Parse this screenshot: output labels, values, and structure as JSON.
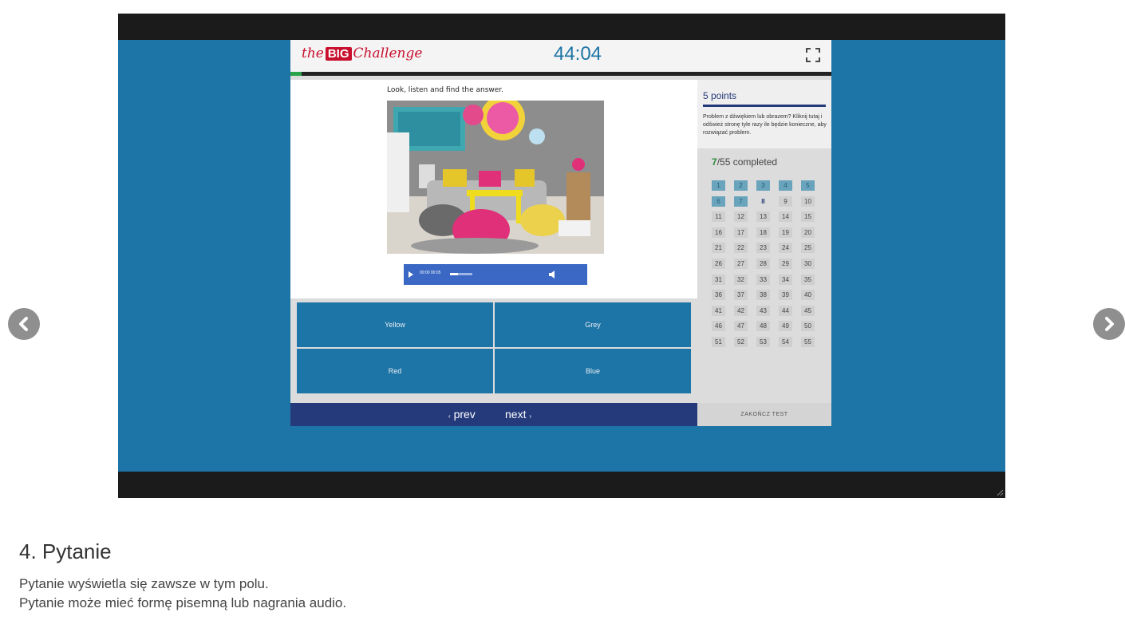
{
  "app": {
    "logo_prefix": "the",
    "logo_big": "BIG",
    "logo_suffix": "Challenge",
    "timer": "44:04",
    "progress_fraction": 0.02
  },
  "question": {
    "instruction": "Look, listen and find the answer.",
    "audio": {
      "time": "00:00 00:05",
      "progress_fraction": 0.35
    }
  },
  "answers": [
    "Yellow",
    "Grey",
    "Red",
    "Blue"
  ],
  "nav": {
    "prev_label": "prev",
    "next_label": "next"
  },
  "side": {
    "points": "5 points",
    "note": "Problem z dźwiękiem lub obrazem? Kliknij tutaj i odśwież stronę tyle razy ile będzie konieczne, aby rozwiązać problem.",
    "completed_count": "7",
    "completed_total": "/55",
    "completed_label": "completed",
    "total_questions": 55,
    "answered_count": 7,
    "current_question": 8,
    "end_test_label": "ZAKOŃCZ TEST"
  },
  "caption": {
    "heading": "4. Pytanie",
    "line1": "Pytanie wyświetla się zawsze w tym polu.",
    "line2": "Pytanie może mieć formę pisemną lub nagrania audio."
  },
  "colors": {
    "stage": "#1d74a6",
    "nav": "#253a7a",
    "logo": "#c8102e",
    "progress": "#2aa44a",
    "answer_button": "#1d74a6"
  }
}
